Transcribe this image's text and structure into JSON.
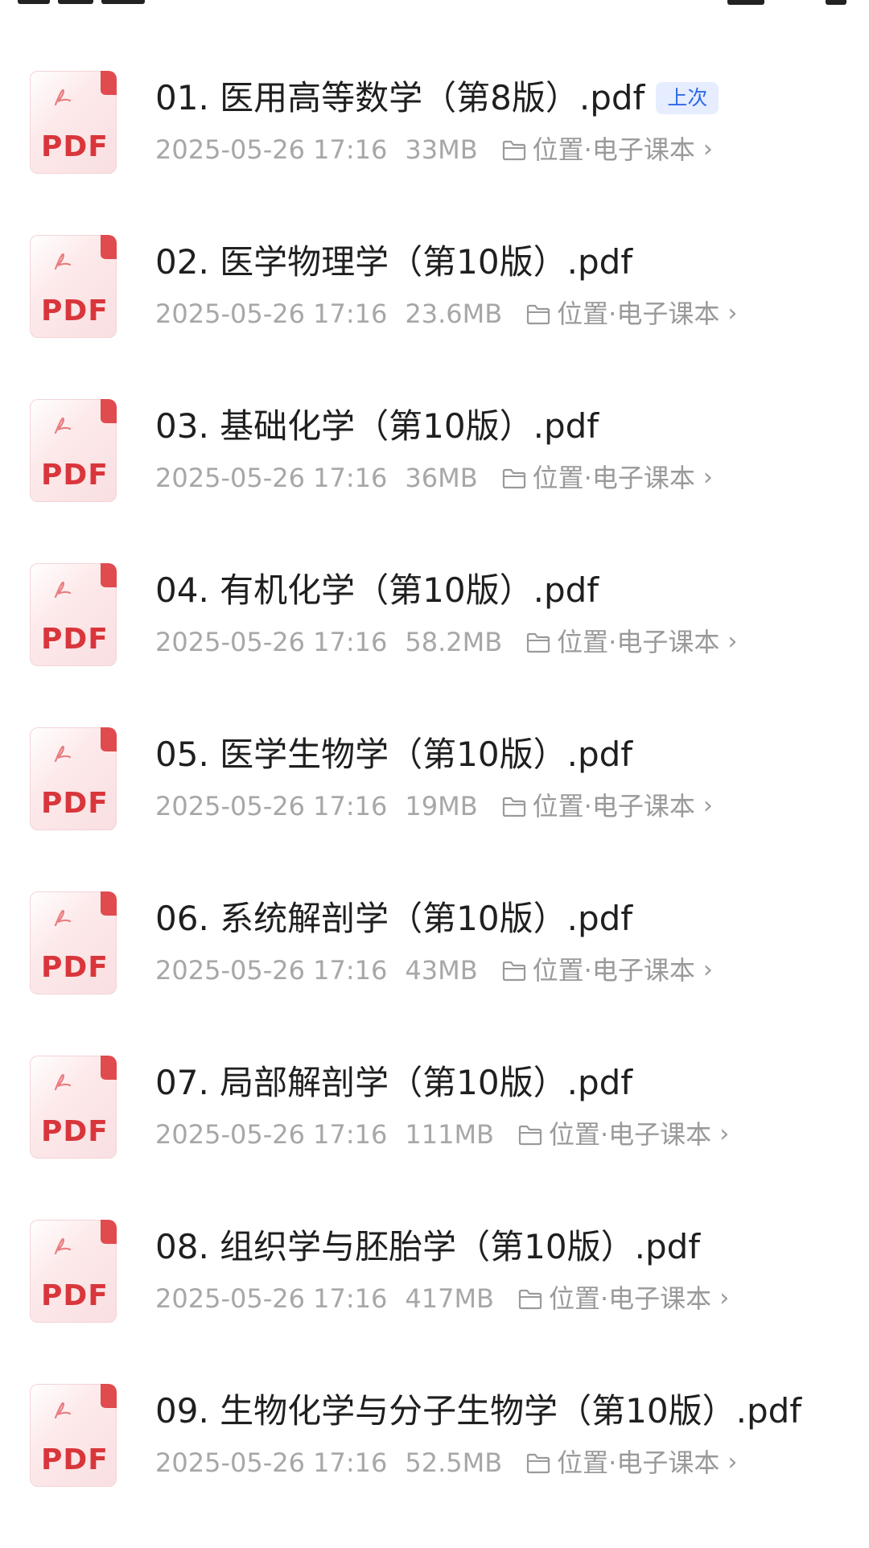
{
  "files": [
    {
      "title": "01. 医用高等数学（第8版）.pdf",
      "badge": "上次",
      "date": "2025-05-26 17:16",
      "size": "33MB",
      "location": "位置·电子课本"
    },
    {
      "title": "02. 医学物理学（第10版）.pdf",
      "badge": "",
      "date": "2025-05-26 17:16",
      "size": "23.6MB",
      "location": "位置·电子课本"
    },
    {
      "title": "03. 基础化学（第10版）.pdf",
      "badge": "",
      "date": "2025-05-26 17:16",
      "size": "36MB",
      "location": "位置·电子课本"
    },
    {
      "title": "04. 有机化学（第10版）.pdf",
      "badge": "",
      "date": "2025-05-26 17:16",
      "size": "58.2MB",
      "location": "位置·电子课本"
    },
    {
      "title": "05. 医学生物学（第10版）.pdf",
      "badge": "",
      "date": "2025-05-26 17:16",
      "size": "19MB",
      "location": "位置·电子课本"
    },
    {
      "title": "06. 系统解剖学（第10版）.pdf",
      "badge": "",
      "date": "2025-05-26 17:16",
      "size": "43MB",
      "location": "位置·电子课本"
    },
    {
      "title": "07. 局部解剖学（第10版）.pdf",
      "badge": "",
      "date": "2025-05-26 17:16",
      "size": "111MB",
      "location": "位置·电子课本"
    },
    {
      "title": "08. 组织学与胚胎学（第10版）.pdf",
      "badge": "",
      "date": "2025-05-26 17:16",
      "size": "417MB",
      "location": "位置·电子课本"
    },
    {
      "title": "09. 生物化学与分子生物学（第10版）.pdf",
      "badge": "",
      "date": "2025-05-26 17:16",
      "size": "52.5MB",
      "location": "位置·电子课本"
    }
  ],
  "icons": {
    "file": "pdf-file-icon",
    "file_label": "PDF",
    "location": "folder-icon",
    "chevron": "chevron-right-icon"
  },
  "colors": {
    "pdf_red": "#d8363b",
    "badge_bg": "#e6edff",
    "badge_text": "#2f6ae6",
    "meta_gray": "#a7a7a7",
    "title": "#1f1f1f"
  }
}
